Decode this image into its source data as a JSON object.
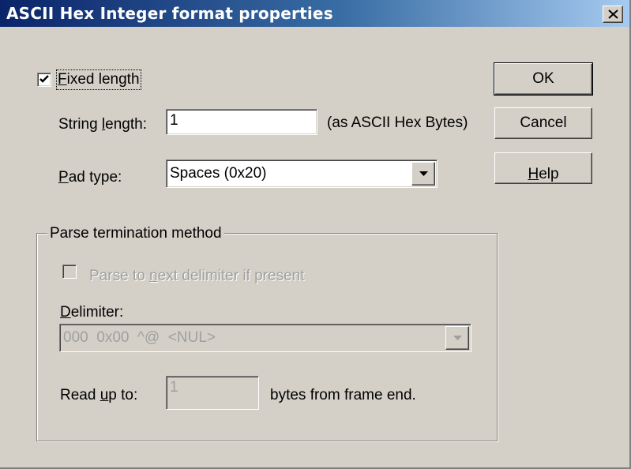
{
  "window": {
    "title": "ASCII Hex Integer format properties"
  },
  "fixed_length": {
    "label": "Fixed length",
    "checked": true
  },
  "string_length": {
    "label": "String length:",
    "value": "1",
    "unit": "(as ASCII Hex Bytes)"
  },
  "pad_type": {
    "label": "Pad type:",
    "value": "Spaces (0x20)"
  },
  "buttons": {
    "ok": "OK",
    "cancel": "Cancel",
    "help": "Help"
  },
  "parse_group": {
    "title": "Parse termination method",
    "delimiter_checkbox_label": "Parse to next delimiter if present",
    "delimiter_checked": false,
    "delimiter_label": "Delimiter:",
    "delimiter_value": "000  0x00  ^@  <NUL>",
    "read_label": "Read up to:",
    "read_value": "1",
    "read_suffix": "bytes from frame end."
  },
  "icons": {
    "close": "close-icon",
    "dropdown": "chevron-down-icon",
    "check": "checkmark-icon"
  }
}
